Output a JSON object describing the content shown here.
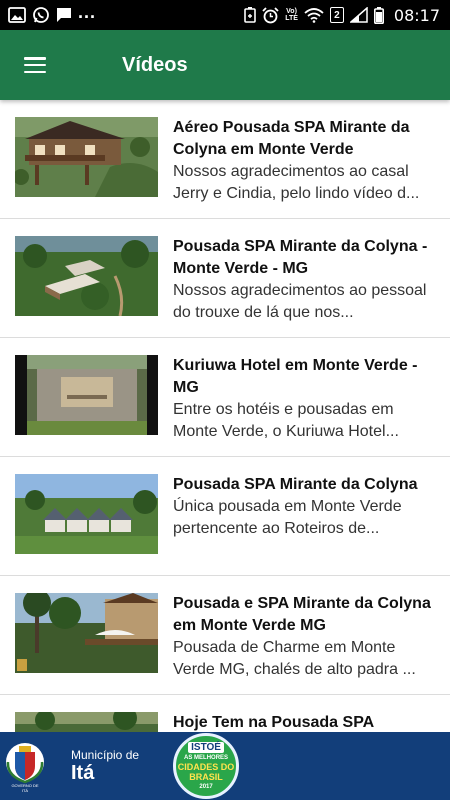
{
  "status_bar": {
    "time": "08:17",
    "network": "LTE",
    "network_top": "Vo)",
    "sim_badge": "2",
    "overflow": "...",
    "icons": [
      "gallery-icon",
      "whatsapp-icon",
      "chat-icon",
      "battery-saver-icon",
      "alarm-icon",
      "wifi-icon",
      "signal-icon",
      "battery-icon"
    ]
  },
  "app_bar": {
    "title": "Vídeos",
    "menu_icon": "hamburger-menu-icon",
    "color": "#1f7a4a"
  },
  "videos": [
    {
      "title": "Aéreo Pousada SPA Mirante da Colyna em Monte Verde",
      "description": "Nossos agradecimentos ao casal Jerry e Cindia, pelo lindo vídeo d...",
      "thumbnail": "chalet-aerial"
    },
    {
      "title": "Pousada SPA Mirante da Colyna - Monte Verde - MG",
      "description": "Nossos agradecimentos ao pessoal do trouxe de lá que nos...",
      "thumbnail": "forest-aerial"
    },
    {
      "title": "Kuriuwa Hotel em Monte Verde - MG",
      "description": "Entre os hotéis e pousadas em Monte Verde, o Kuriuwa Hotel...",
      "thumbnail": "stone-wall-sign"
    },
    {
      "title": "Pousada SPA Mirante da Colyna",
      "description": "Única pousada em Monte Verde pertencente ao Roteiros de...",
      "thumbnail": "chalets-row"
    },
    {
      "title": "Pousada e SPA Mirante da Colyna em Monte Verde MG",
      "description": "Pousada de Charme em Monte Verde MG, chalés de alto padra ...",
      "thumbnail": "deck-trees"
    },
    {
      "title": "Hoje Tem na Pousada SPA",
      "description": "",
      "thumbnail": "partial"
    }
  ],
  "footer": {
    "municipio_label": "Município de",
    "city_name": "Itá",
    "crest_caption": "GOVERNO DE ITÁ",
    "badge_top": "ISTOÉ",
    "badge_mid": "AS MELHORES",
    "badge_big": "CIDADES DO BRASIL",
    "badge_year": "2017",
    "color": "#123e7a"
  }
}
